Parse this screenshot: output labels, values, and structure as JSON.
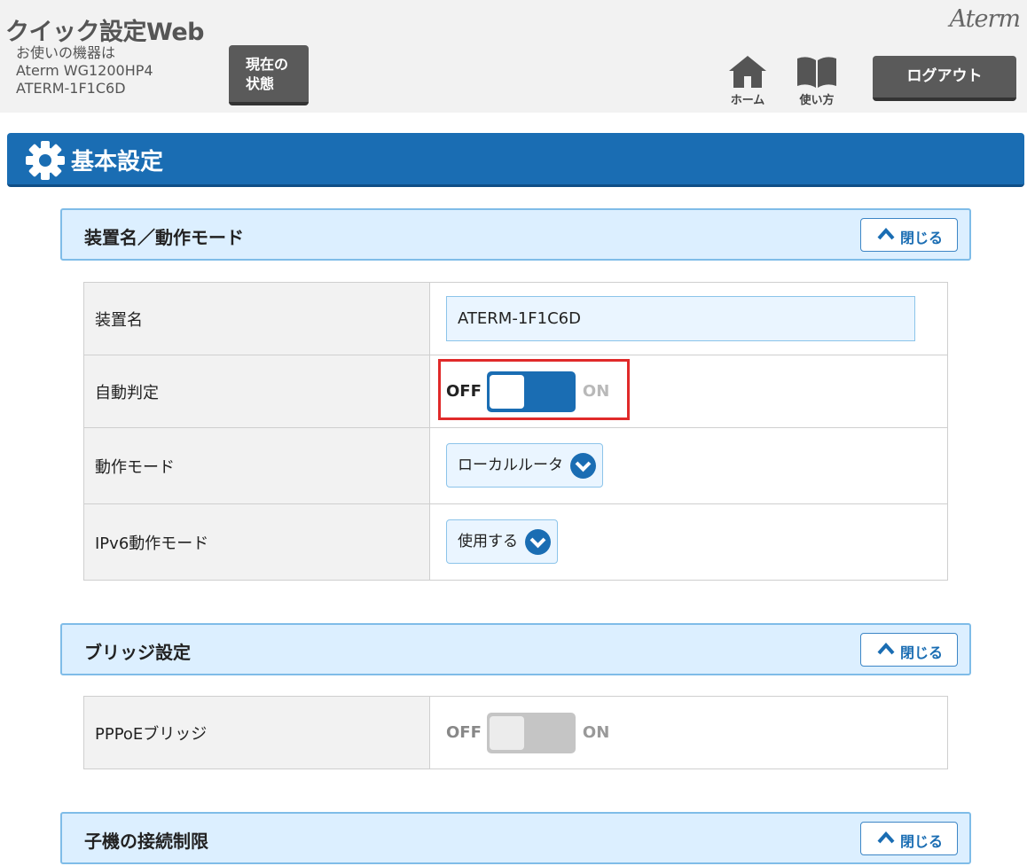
{
  "header": {
    "app_title": "クイック設定Web",
    "device_info_line1": "お使いの機器は",
    "device_model": "Aterm WG1200HP4",
    "device_name": "ATERM-1F1C6D",
    "status_button_line1": "現在の",
    "status_button_line2": "状態",
    "brand": "Aterm",
    "home_label": "ホーム",
    "help_label": "使い方",
    "logout_label": "ログアウト"
  },
  "section": {
    "title": "基本設定"
  },
  "panels": [
    {
      "title": "装置名／動作モード",
      "close_label": "閉じる",
      "rows": {
        "device_name_label": "装置名",
        "device_name_value": "ATERM-1F1C6D",
        "auto_detect_label": "自動判定",
        "auto_detect_off": "OFF",
        "auto_detect_on": "ON",
        "operation_mode_label": "動作モード",
        "operation_mode_value": "ローカルルータ",
        "ipv6_mode_label": "IPv6動作モード",
        "ipv6_mode_value": "使用する"
      }
    },
    {
      "title": "ブリッジ設定",
      "close_label": "閉じる",
      "rows": {
        "pppoe_bridge_label": "PPPoEブリッジ",
        "pppoe_off": "OFF",
        "pppoe_on": "ON"
      }
    },
    {
      "title": "子機の接続制限",
      "close_label": "閉じる"
    }
  ],
  "colors": {
    "accent": "#1a6db3",
    "highlight": "#e02a2a",
    "panel_header_bg": "#dcefff"
  }
}
